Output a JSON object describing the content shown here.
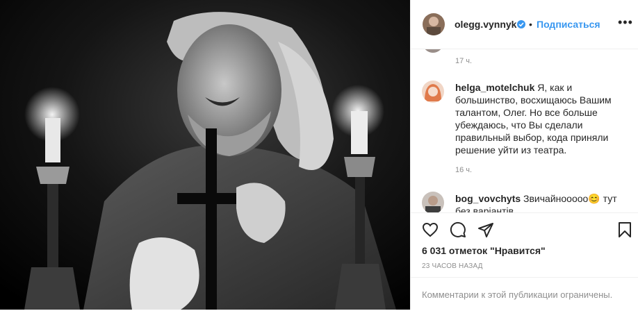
{
  "post": {
    "photo_alt": "black and white stage photo of actor with cross and candles"
  },
  "header": {
    "username": "olegg.vynnyk",
    "separator": "•",
    "follow_label": "Подписаться",
    "more_label": "•••"
  },
  "comments": [
    {
      "time": "17 ч."
    },
    {
      "username": "helga_motelchuk",
      "lines": [
        "Я, как и",
        "большинство, восхищаюсь Вашим",
        "талантом, Олег. Но все больше",
        "убеждаюсь, что Вы сделали",
        "правильный выбор, кода приняли",
        "решение уйти из театра."
      ],
      "time": "16 ч."
    },
    {
      "username": "bog_vovchyts",
      "lines": [
        "Звичайнооооо😊 тут",
        "без варіантів"
      ]
    }
  ],
  "actions": {
    "likes": "6 031 отметок \"Нравится\"",
    "ago": "23 ЧАСОВ НАЗАД",
    "restricted": "Комментарии к этой публикации ограничены."
  },
  "icons": [
    "heart-icon",
    "comment-icon",
    "share-icon",
    "bookmark-icon",
    "verified-icon"
  ],
  "colors": {
    "link": "#3897f0",
    "muted": "#8e8e8e",
    "text": "#262626"
  }
}
